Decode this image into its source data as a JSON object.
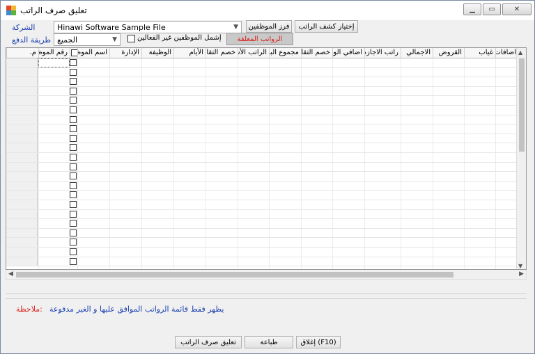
{
  "window": {
    "title": "تعليق صرف الراتب",
    "minimize": "▁",
    "restore": "▭",
    "close": "✕"
  },
  "filters": {
    "company_label": "الشركة",
    "company_value": "Hinawi Software Sample File",
    "payment_label": "طريقة الدفع",
    "payment_value": "الجميع",
    "include_inactive_label": "إشمل الموظفين غير الفعالين",
    "sort_button": "فرز الموظفين",
    "choose_payslip_button": "إختيار كشف الراتب",
    "suspended_button": "الرواتب المعلقة"
  },
  "grid": {
    "columns": [
      "م.",
      "رقم الموظف",
      "",
      "اسم الموظف",
      "الإدارة",
      "الوظيفة",
      "الأيام",
      "خصم التقاعد",
      "الراتب الأساسي",
      "مجموع البدلات",
      "خصم التقاعد",
      "اضافي الوقت الإضافي",
      "راتب الاجازة",
      "الاجمالي",
      "القروض",
      "غياب",
      "اضافات"
    ],
    "row_count": 22
  },
  "note": {
    "label": ":ملاحظة",
    "text": "يظهر فقط قائمة الرواتب الموافق عليها و الغير مدفوعة"
  },
  "actions": {
    "suspend_button": "تعليق صرف الراتب",
    "print_button": "طباعة",
    "close_button": "(F10) إغلاق"
  }
}
